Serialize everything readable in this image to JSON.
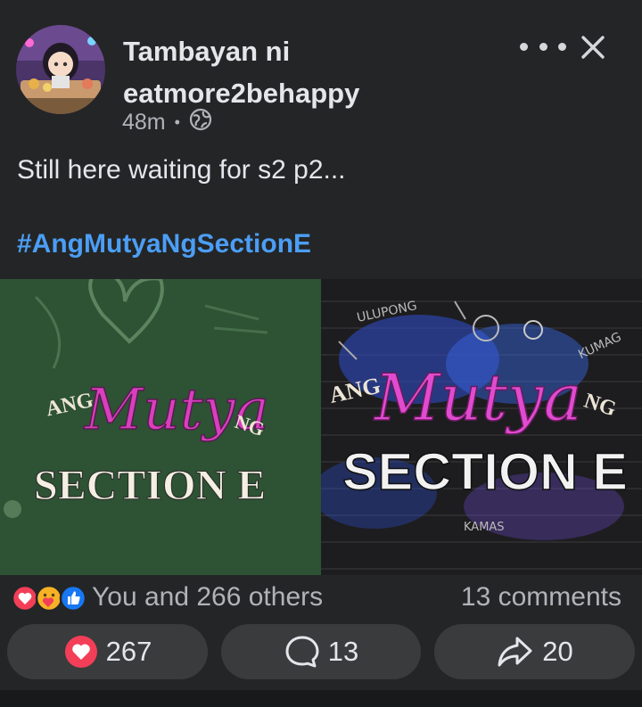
{
  "post": {
    "author_name": "Tambayan ni eatmore2behappy",
    "time": "48m",
    "privacy_icon": "globe-icon",
    "text": "Still here waiting for s2 p2...",
    "hashtag": "#AngMutyaNgSectionE"
  },
  "media": {
    "left_image": {
      "title_top": "ANG",
      "title_script": "Mutya",
      "title_ng": "NG",
      "title_bottom": "SECTION E"
    },
    "right_image": {
      "title_top": "ANG",
      "title_script": "Mutya",
      "title_ng": "NG",
      "title_bottom": "SECTION E",
      "graffiti": [
        "ULUPONG",
        "KUMAG",
        "KAMAS"
      ]
    }
  },
  "reactions": {
    "icons": [
      "love-icon",
      "care-icon",
      "like-icon"
    ],
    "summary": "You and 266 others",
    "comments": "13 comments"
  },
  "actions": {
    "react_count": "267",
    "comment_count": "13",
    "share_count": "20"
  },
  "colors": {
    "background": "#242526",
    "hashtag": "#4b9ef5",
    "button_bg": "#3a3b3c",
    "love": "#f33e58",
    "like": "#1877f2"
  }
}
